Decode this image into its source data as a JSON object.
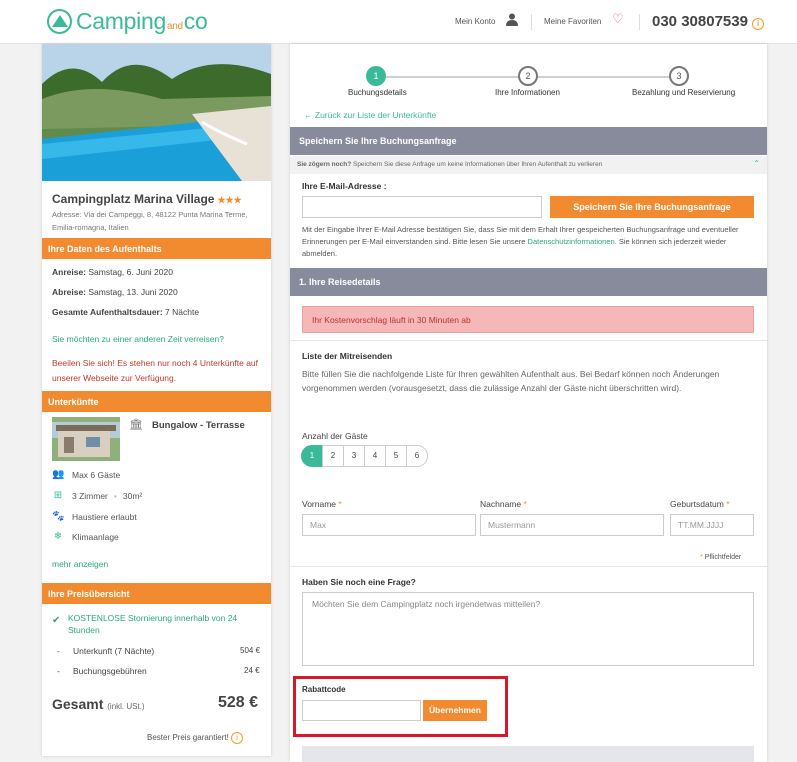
{
  "header": {
    "logo_main": "Camping",
    "logo_and": "and",
    "logo_co": "co",
    "account": "Mein Konto",
    "favorites": "Meine Favoriten",
    "phone": "030 30807539"
  },
  "camp": {
    "name": "Campingplatz Marina Village",
    "stars": "★★★",
    "address": "Adresse: Via dei Campeggi, 8, 48122 Punta Marina Terme, Emilia-romagna, Italien"
  },
  "stay": {
    "heading": "Ihre Daten des Aufenthalts",
    "arrival_label": "Anreise:",
    "arrival": " Samstag, 6. Juni 2020",
    "departure_label": "Abreise:",
    "departure": " Samstag, 13. Juni 2020",
    "duration_label": "Gesamte Aufenthaltsdauer:",
    "duration": " 7 Nächte",
    "other_time": "Sie möchten zu einer anderen Zeit verreisen?",
    "hurry": "Beeilen Sie sich! Es stehen nur noch 4 Unterkünfte auf unserer Webseite zur Verfügung."
  },
  "accommodation": {
    "heading": "Unterkünfte",
    "type": "Bungalow - Terrasse",
    "guests": "Max 6 Gäste",
    "rooms": "3 Zimmer",
    "area": "30m²",
    "pets": "Haustiere erlaubt",
    "ac": "Klimaanlage",
    "more": "mehr anzeigen"
  },
  "price": {
    "heading": "Ihre Preisübersicht",
    "free_cancel": "KOSTENLOSE Stornierung innerhalb von 24 Stunden",
    "lines": [
      {
        "label": "Unterkunft (7 Nächte)",
        "value": "504 €"
      },
      {
        "label": "Buchungsgebühren",
        "value": "24 €"
      }
    ],
    "total_label": "Gesamt",
    "total_note": "(inkl. USt.)",
    "total": "528 €",
    "best": "Bester Preis garantiert!"
  },
  "steps": [
    {
      "n": "1",
      "label": "Buchungsdetails"
    },
    {
      "n": "2",
      "label": "Ihre Informationen"
    },
    {
      "n": "3",
      "label": "Bezahlung und Reservierung"
    }
  ],
  "back": "Zurück zur Liste der Unterkünfte",
  "save": {
    "heading": "Speichern Sie Ihre Buchungsanfrage",
    "hesitate_b": "Sie zögern noch?",
    "hesitate": " Speichern Sie diese Anfrage um keine Informationen über Ihren Aufenthalt zu verlieren",
    "email_label": "Ihre E-Mail-Adresse :",
    "email_value": "",
    "button": "Speichern Sie Ihre Buchungsanfrage",
    "notice": "Mit der Eingabe Ihrer E-Mail Adresse bestätigen Sie, dass Sie mit dem Erhalt Ihrer gespeicherten Buchungsanfrage und eventueller Erinnerungen per E-Mail einverstanden sind. Bitte lesen Sie unsere ",
    "privacy": "Datenschutzinformationen",
    "notice2": ". Sie können sich jederzeit wieder abmelden."
  },
  "travel": {
    "heading": "1. Ihre Reisedetails",
    "alert": "Ihr Kostenvorschlag läuft in 30 Minuten ab",
    "list_title": "Liste der Mitreisenden",
    "list_text": "Bitte füllen Sie die nachfolgende Liste für Ihren gewählten Aufenthalt aus. Bei Bedarf können noch Änderungen vorgenommen werden (vorausgesetzt, dass die zulässige Anzahl der Gäste nicht überschritten wird).",
    "guest_label": "Anzahl der Gäste",
    "guest_options": [
      "1",
      "2",
      "3",
      "4",
      "5",
      "6"
    ],
    "first_label": "Vorname",
    "first_ph": "Max",
    "last_label": "Nachname",
    "last_ph": "Mustermann",
    "birth_label": "Geburtsdatum",
    "birth_ph": "TT.MM.JJJJ",
    "required": "Pflichtfelder",
    "question": "Haben Sie noch eine Frage?",
    "question_ph": "Möchten Sie dem Campingplatz noch irgendetwas mitteilen?",
    "coupon_label": "Rabattcode",
    "coupon_value": "",
    "coupon_button": "Übernehmen"
  }
}
